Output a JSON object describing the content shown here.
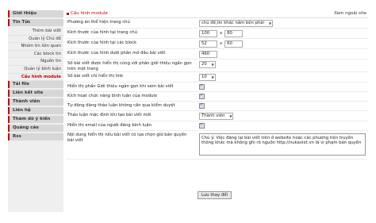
{
  "sidebar": {
    "items": [
      {
        "label": "Giới thiệu",
        "type": "cat"
      },
      {
        "label": "Tin Tức",
        "type": "cat"
      },
      {
        "label": "Thêm bài viết",
        "type": "sub"
      },
      {
        "label": "Quản lý Chủ đề",
        "type": "sub"
      },
      {
        "label": "Nhóm tin liên quan",
        "type": "sub"
      },
      {
        "label": "Các block tin",
        "type": "sub"
      },
      {
        "label": "Nguồn tin",
        "type": "sub"
      },
      {
        "label": "Quản lý bình luận",
        "type": "sub"
      },
      {
        "label": "Cấu hình module",
        "type": "sub",
        "active": true
      },
      {
        "label": "Tải file",
        "type": "cat"
      },
      {
        "label": "Liên kết site",
        "type": "cat"
      },
      {
        "label": "Thành viên",
        "type": "cat"
      },
      {
        "label": "Liên hệ",
        "type": "cat"
      },
      {
        "label": "Thăm dò ý kiến",
        "type": "cat"
      },
      {
        "label": "Quảng cáo",
        "type": "cat"
      },
      {
        "label": "Rss",
        "type": "cat"
      }
    ]
  },
  "header": {
    "title": "Cấu hình module",
    "external_link": "Xem ngoài site"
  },
  "form": {
    "rows": [
      {
        "label": "Phương án thể hiện trang chủ",
        "select": "chủ đề,tin khác nằm bên phải",
        "h": 12
      },
      {
        "label": "Kích thước của hình tại trang chủ",
        "inputs": [
          "100",
          "80"
        ],
        "h": 12
      },
      {
        "label": "Kích thước của hình tại các block",
        "inputs": [
          "52",
          "60"
        ],
        "h": 12
      },
      {
        "label": "Kích thước của hình dưới phần mở đầu bài viết",
        "inputs": [
          "460"
        ],
        "h": 12
      },
      {
        "label": "Số bài viết được hiển thị cùng với phần giới thiệu ngắn gọn trên một trang",
        "select": "20",
        "h": 15
      },
      {
        "label": "Số bài viết chỉ hiển thị link",
        "select": "10",
        "h": 12
      },
      {
        "label": "Hiển thị phần Giới thiệu ngắn gọn khi xem bài viết",
        "check": true,
        "h": 11
      },
      {
        "label": "Kích hoạt chức năng bình luận của module",
        "check": true,
        "h": 11
      },
      {
        "label": "Tự động đăng thảo luận không cần qua kiểm duyệt",
        "check": true,
        "h": 11
      },
      {
        "label": "Thảo luận mặc định khi tạo bài viết mới",
        "select": "Thành viên",
        "h": 12
      },
      {
        "label": "Hiển thị email của người đăng bình luận",
        "check": true,
        "h": 11
      },
      {
        "label": "Nội dung hiển thị nếu bài viết có lựa chọn giữ bản quyền bài viết",
        "textarea": "Chú ý: Việc đăng lại bài viết trên ở website hoặc các phương tiện truyền thông khác mà không ghi rõ nguồn http://nukaviet.vn là vi phạm bản quyền",
        "h": 35
      }
    ],
    "submit": "Lưu thay đổi"
  }
}
